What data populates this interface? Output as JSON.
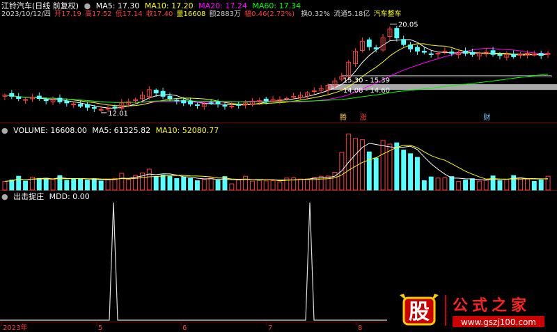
{
  "header": {
    "stock_title": "江铃汽车(日线 前复权)",
    "date_label": "2023/10/12/四",
    "open": "开17.19",
    "high": "高17.52",
    "low": "低17.14",
    "close": "收17.40",
    "volume": "量16608",
    "amount": "额2883万",
    "change": "幅0.46(2.72%)",
    "turnover": "换0.32%",
    "float_cap": "流通5.18亿",
    "sector": "汽车整车"
  },
  "legend": {
    "ma5": "MA5: 17.30",
    "ma10": "MA10: 17.20",
    "ma20": "MA20: 17.24",
    "ma60": "MA60: 17.34"
  },
  "volume_panel": {
    "label": "VOLUME: 16608.00",
    "ma5": "MA5: 61325.82",
    "ma10": "MA10: 52080.77"
  },
  "indicator_panel": {
    "name": "出击捉庄",
    "value": "MDD: 0.00"
  },
  "annotations": {
    "high_price": "20.05",
    "low_price": "12.01",
    "gap1": "15.30 - 15.39",
    "gap2": "14.08 - 14.60",
    "tag1": "腾",
    "tag2": "涨",
    "tag3": "财"
  },
  "x_axis": [
    "2023年",
    "5",
    "6",
    "7",
    "8"
  ],
  "watermark": {
    "brand": "股",
    "text": "公式之家",
    "url": "www.gszj100.com"
  },
  "colors": {
    "up": "#ff3c3c",
    "down": "#54ffff",
    "ma5": "#ffffff",
    "ma10": "#ffff00",
    "ma20": "#ff00ff",
    "ma60": "#00ff00",
    "grid": "#7a0000"
  },
  "chart_data": {
    "type": "candlestick",
    "title": "江铃汽车(日线 前复权)",
    "price_range": [
      11.5,
      20.6
    ],
    "price_series_close_approx": [
      13.6,
      13.5,
      13.3,
      13.2,
      13.4,
      13.3,
      13.1,
      13.2,
      13.0,
      12.9,
      12.8,
      12.6,
      12.5,
      12.4,
      12.3,
      12.4,
      12.5,
      12.9,
      13.0,
      13.2,
      13.6,
      14.1,
      13.8,
      13.5,
      13.3,
      13.1,
      12.9,
      12.8,
      12.7,
      12.8,
      12.9,
      12.8,
      12.6,
      12.6,
      12.7,
      12.9,
      13.0,
      13.1,
      13.1,
      13.2,
      13.2,
      13.3,
      13.5,
      13.6,
      13.8,
      14.0,
      14.2,
      14.5,
      14.9,
      15.3,
      16.6,
      17.6,
      18.5,
      18.0,
      17.8,
      18.8,
      19.6,
      18.8,
      18.2,
      17.8,
      17.6,
      17.5,
      17.3,
      17.4,
      17.6,
      17.4,
      17.5,
      17.4,
      17.3,
      17.4,
      17.5,
      17.3,
      17.2,
      17.3,
      17.1,
      17.3,
      17.4,
      17.3,
      17.2,
      17.4
    ],
    "volume_range": [
      0,
      140000
    ],
    "indicator": {
      "name": "MDD",
      "spikes_at_months": [
        "5",
        "8"
      ],
      "value": 0.0
    }
  }
}
